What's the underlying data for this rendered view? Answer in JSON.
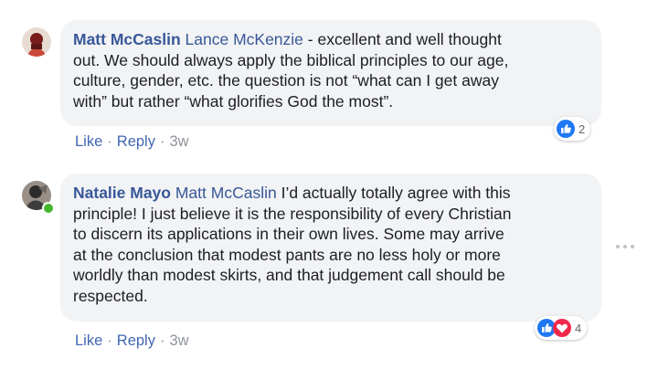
{
  "comments": [
    {
      "author": "Matt McCaslin",
      "mention": "Lance McKenzie",
      "lines": [
        " - excellent and well thought",
        "out. We should always apply the biblical principles to our age,",
        "culture, gender, etc. the question is not “what can I get away",
        "with” but rather “what glorifies God the most”."
      ],
      "actions": {
        "like": "Like",
        "reply": "Reply",
        "time": "3w",
        "sep": "·"
      },
      "reaction_count": "2",
      "reaction_icons": [
        "like-icon"
      ],
      "avatar_colors": [
        "#7a1c1c",
        "#c94a3a"
      ]
    },
    {
      "author": "Natalie Mayo",
      "mention": "Matt McCaslin",
      "lines": [
        " I’d actually totally agree with this",
        "principle! I just believe it is the responsibility of every Christian",
        "to discern its applications in their own lives. Some may arrive",
        "at the conclusion that modest pants are no less holy or more",
        "worldly than modest skirts, and that judgement call should be",
        "respected."
      ],
      "actions": {
        "like": "Like",
        "reply": "Reply",
        "time": "3w",
        "sep": "·"
      },
      "reaction_count": "4",
      "reaction_icons": [
        "like-icon",
        "love-icon"
      ],
      "avatar_colors": [
        "#2c2c2c",
        "#9a8f86"
      ],
      "online": true
    }
  ],
  "colors": {
    "bubble": "#f2f3f5",
    "name": "#385898",
    "link": "#4267b2",
    "meta": "#90949c",
    "like": "#2078f4",
    "love": "#f0284a",
    "online": "#42b72a"
  }
}
